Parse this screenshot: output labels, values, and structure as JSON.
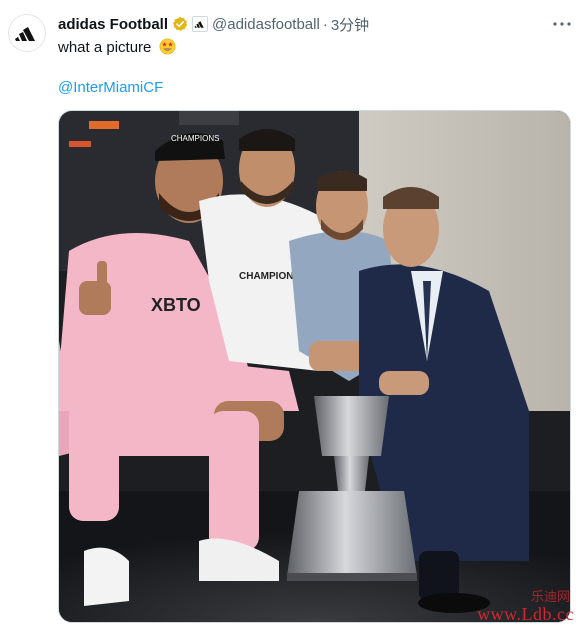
{
  "tweet": {
    "author": {
      "display_name": "adidas Football",
      "handle": "@adidasfootball",
      "verified_icon": "gold-verified-badge-icon",
      "affiliate_icon": "adidas-affiliate-badge-icon",
      "avatar_icon": "adidas-logo-icon"
    },
    "separator": "·",
    "timestamp": "3分钟",
    "more_icon": "more-options-icon",
    "text": "what a picture",
    "emoji": "star-struck-emoji",
    "mention": "@InterMiamiCF",
    "photo": {
      "description_icon": "team-photo-image",
      "jersey_sponsor": "XBTO",
      "cap_text": "CHAMPIONS",
      "shirt_text": "CHAMPIONS"
    }
  },
  "watermark": {
    "text": "www.Ldb.cc",
    "site_cn": "乐迪网"
  },
  "colors": {
    "link": "#1d9bf0",
    "secondary_text": "#536471",
    "verified_gold": "#e2b719",
    "watermark": "#d0282e",
    "jersey_pink": "#f3b7c8"
  }
}
